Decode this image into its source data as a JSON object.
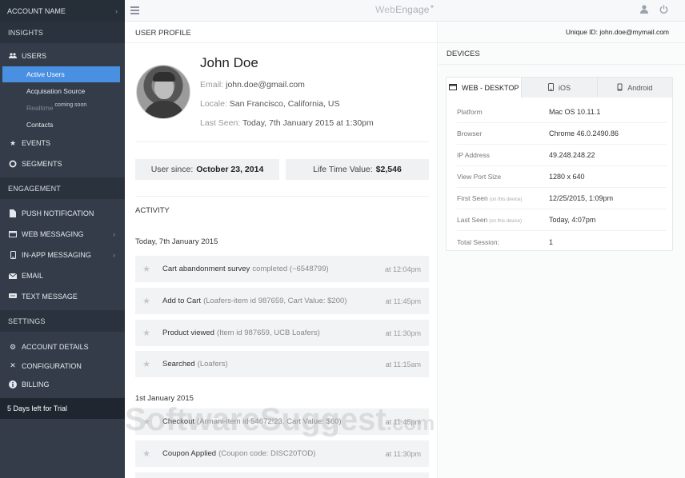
{
  "sidebar": {
    "account_name": "ACCOUNT NAME",
    "sections": {
      "insights": "INSIGHTS",
      "engagement": "ENGAGEMENT",
      "settings": "SETTINGS"
    },
    "users": "USERS",
    "users_sub": {
      "active": "Active Users",
      "acquisition": "Acquisation Source",
      "realtime": "Realtime",
      "realtime_badge": "coming soon",
      "contacts": "Contacts"
    },
    "events": "EVENTS",
    "segments": "SEGMENTS",
    "push": "PUSH NOTIFICATION",
    "web_messaging": "WEB MESSAGING",
    "inapp": "IN-APP MESSAGING",
    "email": "EMAIL",
    "text": "TEXT MESSAGE",
    "account_details": "ACCOUNT DETAILS",
    "configuration": "CONFIGURATION",
    "billing": "BILLING",
    "trial": "5 Days left for Trial"
  },
  "topbar": {
    "brand_a": "Web",
    "brand_b": "Engage"
  },
  "header": {
    "title": "USER PROFILE",
    "unique_id_label": "Unique ID:",
    "unique_id": "john.doe@mymail.com"
  },
  "profile": {
    "name": "John Doe",
    "email_label": "Email:",
    "email": "john.doe@gmail.com",
    "locale_label": "Locale:",
    "locale": "San Francisco, California, US",
    "last_seen_label": "Last Seen:",
    "last_seen": "Today, 7th January 2015 at 1:30pm",
    "user_since_label": "User since:",
    "user_since": "October 23, 2014",
    "ltv_label": "Life Time Value:",
    "ltv": "$2,546"
  },
  "activity": {
    "title": "ACTIVITY",
    "groups": [
      {
        "date": "Today, 7th January 2015",
        "items": [
          {
            "label": "Cart abandonment survey",
            "detail": "completed (~6548799)",
            "time": "at 12:04pm"
          },
          {
            "label": "Add to Cart",
            "detail": "(Loafers-item id 987659, Cart Value: $200)",
            "time": "at 11:45pm"
          },
          {
            "label": "Product viewed",
            "detail": "(Item id 987659, UCB Loafers)",
            "time": "at 11:30pm"
          },
          {
            "label": "Searched",
            "detail": "(Loafers)",
            "time": "at 11:15am"
          }
        ]
      },
      {
        "date": "1st January 2015",
        "items": [
          {
            "label": "Checkout",
            "detail": "(Armani-item id 54672!23, Cart Value: $60)",
            "time": "at 11:45pm"
          },
          {
            "label": "Coupon Applied",
            "detail": "(Coupon code: DISC20TOD)",
            "time": "at 11:30pm"
          }
        ]
      }
    ]
  },
  "devices": {
    "title": "DEVICES",
    "tabs": [
      "WEB - DESKTOP",
      "iOS",
      "Android"
    ],
    "rows": [
      {
        "key": "Platform",
        "note": "",
        "value": "Mac OS 10.11.1"
      },
      {
        "key": "Browser",
        "note": "",
        "value": "Chrome 46.0.2490.86"
      },
      {
        "key": "IP Address",
        "note": "",
        "value": "49.248.248.22"
      },
      {
        "key": "View Port Size",
        "note": "",
        "value": "1280 x 640"
      },
      {
        "key": "First Seen",
        "note": "(on this device)",
        "value": "12/25/2015, 1:09pm"
      },
      {
        "key": "Last Seen",
        "note": "(on this device)",
        "value": "Today, 4:07pm"
      },
      {
        "key": "Total Session:",
        "note": "",
        "value": "1"
      }
    ]
  },
  "watermark": {
    "main": "SoftwareSuggest",
    "suffix": ".com"
  }
}
